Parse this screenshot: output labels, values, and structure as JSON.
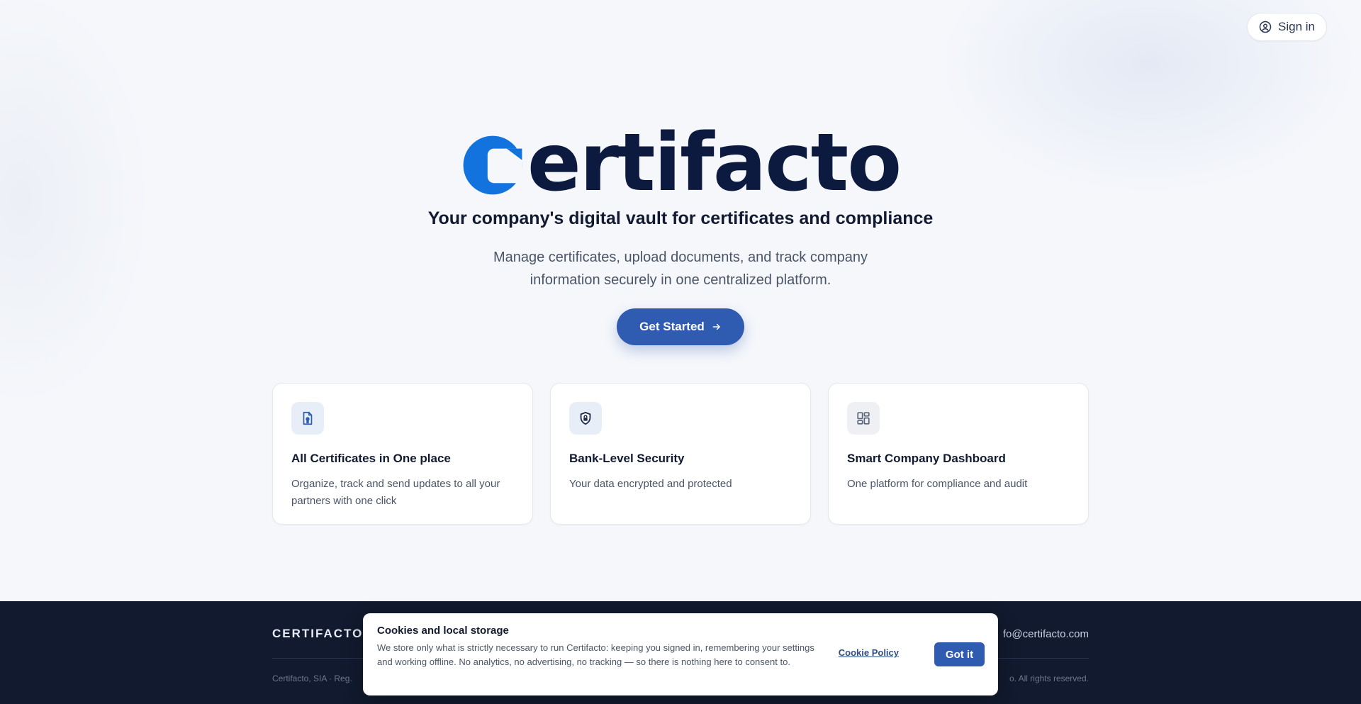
{
  "header": {
    "signin_label": "Sign in"
  },
  "hero": {
    "logo_text": "ertifacto",
    "tagline": "Your company's digital vault for certificates and compliance",
    "description": "Manage certificates, upload documents, and track company information securely in one centralized platform.",
    "cta_label": "Get Started"
  },
  "features": [
    {
      "title": "All Certificates in One place",
      "text": "Organize, track and send updates to all your partners with one click",
      "icon": "document-icon"
    },
    {
      "title": "Bank-Level Security",
      "text": "Your data encrypted and protected",
      "icon": "shield-lock-icon"
    },
    {
      "title": "Smart Company Dashboard",
      "text": "One platform for compliance and audit",
      "icon": "dashboard-icon"
    }
  ],
  "footer": {
    "brand": "CERTIFACTO",
    "email": "fo@certifacto.com",
    "left_text": "Certifacto, SIA · Reg.",
    "right_text": "o. All rights reserved."
  },
  "cookie": {
    "title": "Cookies and local storage",
    "text": "We store only what is strictly necessary to run Certifacto: keeping you signed in, remembering your settings and working offline. No analytics, no advertising, no tracking — so there is nothing here to consent to.",
    "policy_label": "Cookie Policy",
    "accept_label": "Got it"
  },
  "colors": {
    "brand_blue": "#1273de",
    "navy": "#0b1a3e",
    "button": "#2f5bb0",
    "footer": "#111a2e"
  }
}
